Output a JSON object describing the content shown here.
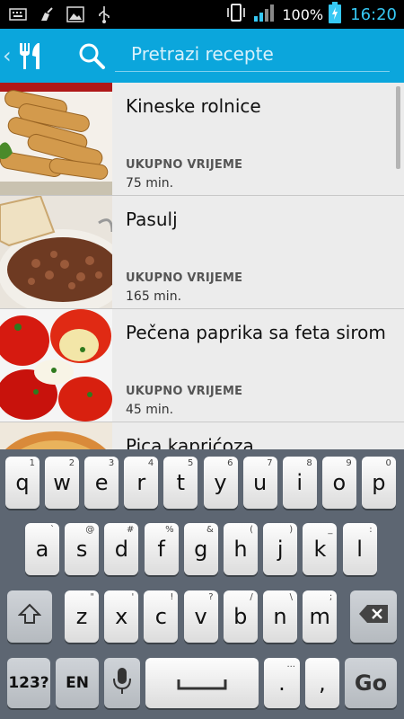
{
  "status_bar": {
    "battery_percent": "100%",
    "time": "16:20",
    "icons": [
      "keyboard-icon",
      "cleaner-icon",
      "image-icon",
      "usb-icon",
      "vibrate-icon",
      "signal-icon",
      "battery-charging-icon"
    ]
  },
  "action_bar": {
    "icons": [
      "back-chevron-icon",
      "fork-knife-icon",
      "search-icon"
    ],
    "search_placeholder": "Pretrazi recepte"
  },
  "recipes": [
    {
      "title": "Kineske rolnice",
      "time_label": "UKUPNO VRIJEME",
      "time_value": "75 min."
    },
    {
      "title": "Pasulj",
      "time_label": "UKUPNO VRIJEME",
      "time_value": "165 min."
    },
    {
      "title": "Pečena paprika sa feta sirom",
      "time_label": "UKUPNO VRIJEME",
      "time_value": "45 min."
    },
    {
      "title": "Pica kaprićoza",
      "time_label": "",
      "time_value": ""
    }
  ],
  "keyboard": {
    "row1": [
      {
        "k": "q",
        "s": "1"
      },
      {
        "k": "w",
        "s": "2"
      },
      {
        "k": "e",
        "s": "3"
      },
      {
        "k": "r",
        "s": "4"
      },
      {
        "k": "t",
        "s": "5"
      },
      {
        "k": "y",
        "s": "6"
      },
      {
        "k": "u",
        "s": "7"
      },
      {
        "k": "i",
        "s": "8"
      },
      {
        "k": "o",
        "s": "9"
      },
      {
        "k": "p",
        "s": "0"
      }
    ],
    "row2": [
      {
        "k": "a",
        "s": "`"
      },
      {
        "k": "s",
        "s": "@"
      },
      {
        "k": "d",
        "s": "#"
      },
      {
        "k": "f",
        "s": "%"
      },
      {
        "k": "g",
        "s": "&"
      },
      {
        "k": "h",
        "s": "("
      },
      {
        "k": "j",
        "s": ")"
      },
      {
        "k": "k",
        "s": "_"
      },
      {
        "k": "l",
        "s": ":"
      }
    ],
    "row3": [
      {
        "k": "z",
        "s": "\""
      },
      {
        "k": "x",
        "s": "'"
      },
      {
        "k": "c",
        "s": "!"
      },
      {
        "k": "v",
        "s": "?"
      },
      {
        "k": "b",
        "s": "/"
      },
      {
        "k": "n",
        "s": "\\"
      },
      {
        "k": "m",
        "s": ";"
      }
    ],
    "shift_icon": "shift-icon",
    "delete_icon": "backspace-icon",
    "symbols_label": "123?",
    "language_label": "EN",
    "mic_icon": "microphone-icon",
    "space_icon": "space-icon",
    "period_label": ".",
    "period_secondary": "...",
    "comma_label": ",",
    "go_label": "Go"
  }
}
